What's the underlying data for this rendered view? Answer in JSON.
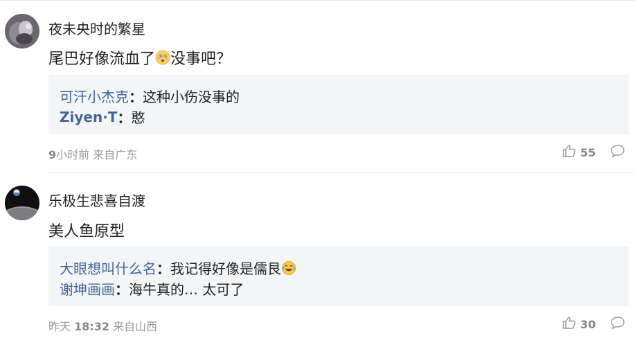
{
  "comments": [
    {
      "username": "夜未央时的繁星",
      "content_before": "尾巴好像流血了",
      "content_emoji": "surprised-face-emoji",
      "content_after": "没事吧？",
      "replies": [
        {
          "name": "可汗小杰克",
          "colon": "：",
          "text": "这种小伤没事的"
        },
        {
          "name": "Ziyen·T",
          "colon": "：",
          "text": "憨"
        }
      ],
      "meta_time_num": "9",
      "meta_time_text": "小时前 来自广东",
      "likes": "55"
    },
    {
      "username": "乐极生悲喜自渡",
      "content": "美人鱼原型",
      "replies": [
        {
          "name": "大眼想叫什么名",
          "colon": "：",
          "text": "我记得好像是儒艮",
          "emoji": "laughing-tears-emoji"
        },
        {
          "name": "谢坤画画",
          "colon": "：",
          "text": "海牛真的… 太可了"
        }
      ],
      "meta_day": "昨天",
      "meta_time_num": "18:32",
      "meta_location": "来自山西",
      "likes": "30"
    }
  ],
  "colors": {
    "link": "#406599",
    "meta": "#999999",
    "reply_bg": "#f4f5f7"
  }
}
